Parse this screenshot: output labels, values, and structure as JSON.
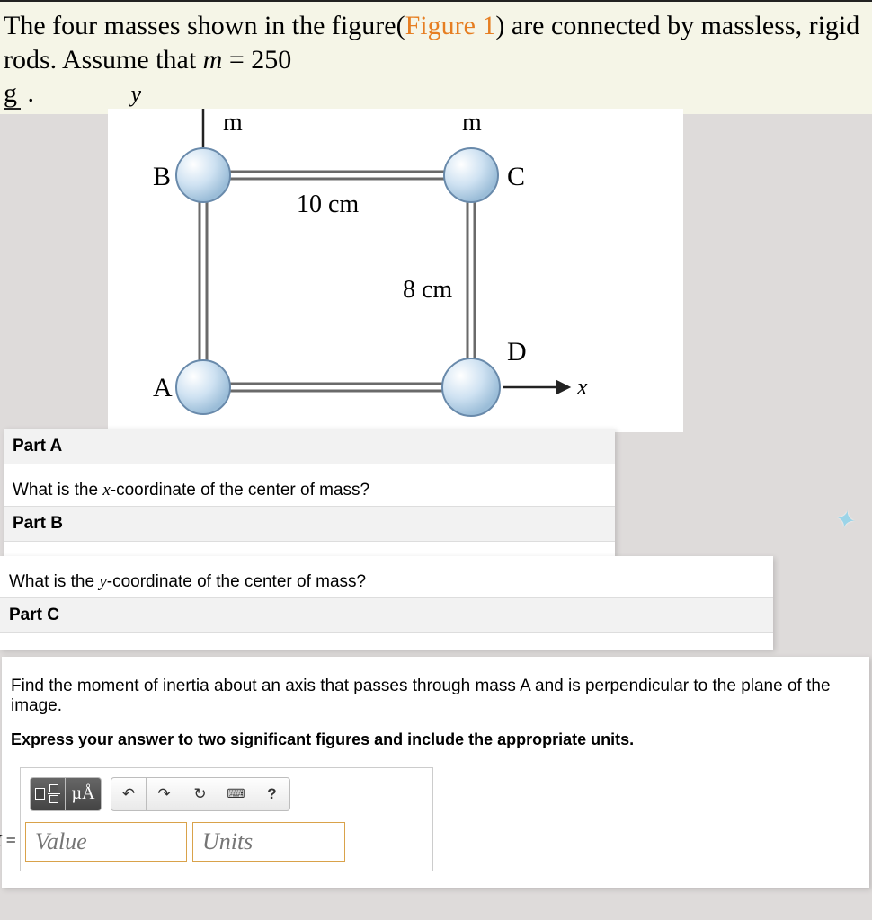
{
  "problem": {
    "text_before": "The four masses shown in the figure(",
    "figure_link": "Figure 1",
    "text_after_link": ") are connected by massless, rigid rods. Assume that ",
    "var": "m",
    "equals": " = 250 ",
    "unit": "g",
    "period": " ."
  },
  "figure": {
    "axis_y": "y",
    "axis_x": "x",
    "top_mass_left": "m",
    "top_mass_right": "m",
    "label_B": "B",
    "label_C": "C",
    "label_A": "A",
    "label_D": "D",
    "width_label": "10 cm",
    "height_label": "8 cm"
  },
  "partA": {
    "header": "Part A",
    "question_before": "What is the ",
    "var": "x",
    "question_after": "-coordinate of the center of mass?"
  },
  "partB": {
    "header": "Part B",
    "question_before": "What is the ",
    "var": "y",
    "question_after": "-coordinate of the center of mass?"
  },
  "partC": {
    "header": "Part C",
    "question": "Find the moment of inertia about an axis that passes through mass A and is perpendicular to the plane of the image.",
    "express": "Express your answer to two significant figures and include the appropriate units."
  },
  "answer": {
    "symbol": "I",
    "equals": " = ",
    "value_placeholder": "Value",
    "units_placeholder": "Units",
    "mu_btn": "µÅ",
    "help_btn": "?"
  }
}
